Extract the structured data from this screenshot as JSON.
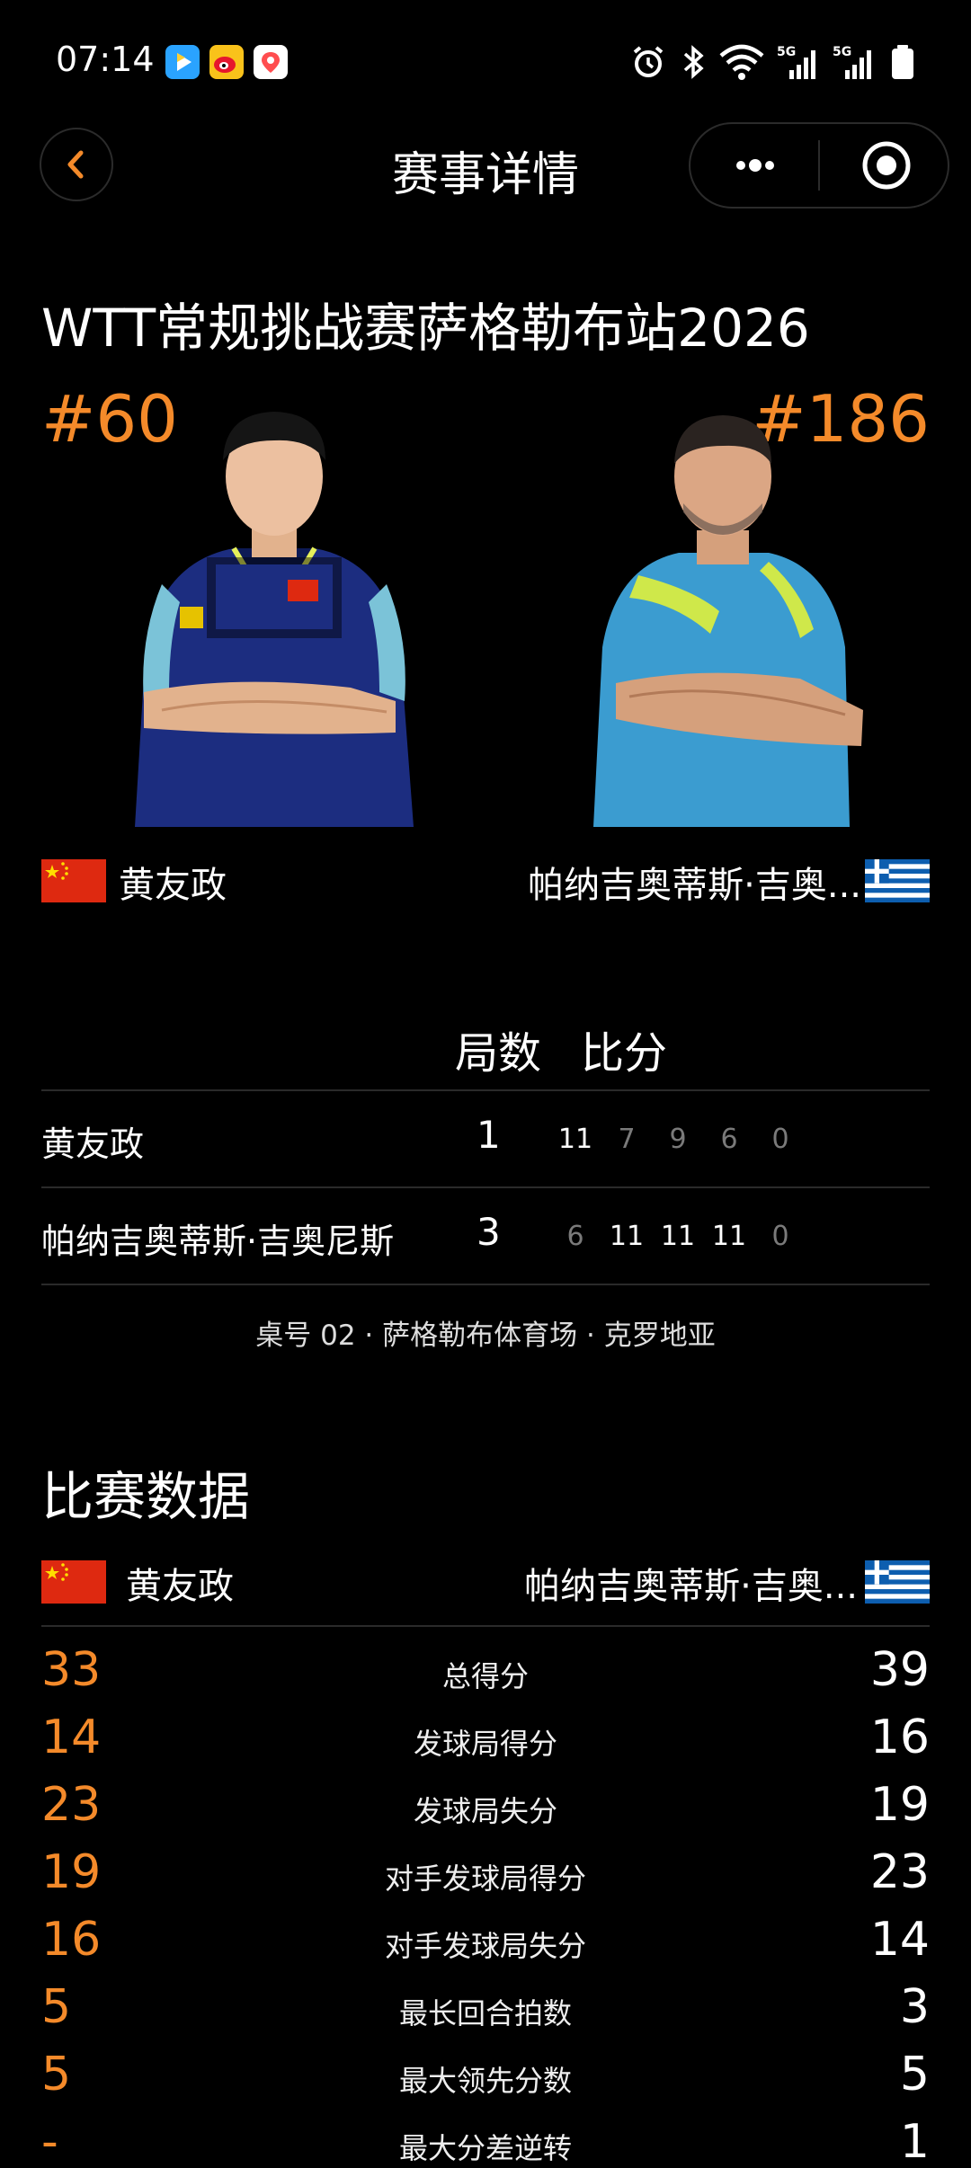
{
  "status_bar": {
    "time": "07:14",
    "net1": "5G",
    "net2": "5G"
  },
  "header": {
    "title": "赛事详情"
  },
  "event": {
    "title": "WTT常规挑战赛萨格勒布站2026"
  },
  "players": {
    "left": {
      "rank": "#60",
      "name": "黄友政",
      "flag": "china-flag"
    },
    "right": {
      "rank": "#186",
      "name": "帕纳吉奥蒂斯·吉奥...",
      "flag": "greece-flag"
    }
  },
  "score": {
    "sets_label": "局数",
    "points_label": "比分",
    "rows": [
      {
        "name": "黄友政",
        "sets": "1",
        "games": [
          "11",
          "7",
          "9",
          "6",
          "0"
        ]
      },
      {
        "name": "帕纳吉奥蒂斯·吉奥尼斯",
        "sets": "3",
        "games": [
          "6",
          "11",
          "11",
          "11",
          "0"
        ]
      }
    ],
    "venue": "桌号 02 · 萨格勒布体育场 · 克罗地亚"
  },
  "stats": {
    "title": "比赛数据",
    "left_name": "黄友政",
    "right_name": "帕纳吉奥蒂斯·吉奥...",
    "rows": [
      {
        "label": "总得分",
        "left": "33",
        "right": "39"
      },
      {
        "label": "发球局得分",
        "left": "14",
        "right": "16"
      },
      {
        "label": "发球局失分",
        "left": "23",
        "right": "19"
      },
      {
        "label": "对手发球局得分",
        "left": "19",
        "right": "23"
      },
      {
        "label": "对手发球局失分",
        "left": "16",
        "right": "14"
      },
      {
        "label": "最长回合拍数",
        "left": "5",
        "right": "3"
      },
      {
        "label": "最大领先分数",
        "left": "5",
        "right": "5"
      },
      {
        "label": "最大分差逆转",
        "left": "-",
        "right": "1"
      }
    ]
  },
  "colors": {
    "accent": "#f48a2a",
    "background": "#000000",
    "muted": "#7a7a7a"
  }
}
